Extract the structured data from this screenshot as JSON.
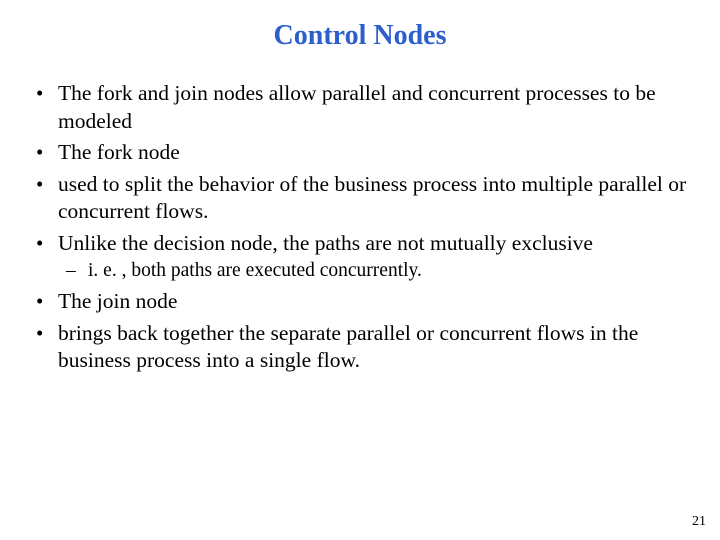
{
  "title": "Control Nodes",
  "bullets": {
    "b0": "The fork and join nodes allow parallel and concurrent processes to be modeled",
    "b1": "The fork node",
    "b2": "used to split the behavior of the business process into multiple parallel or concurrent flows.",
    "b3": "Unlike the decision node, the paths are not mutually exclusive",
    "b3_sub0": "i. e. , both paths are executed concurrently.",
    "b4": "The join node",
    "b5": "brings back together the separate parallel or concurrent flows in the business process into a single flow."
  },
  "page_number": "21"
}
